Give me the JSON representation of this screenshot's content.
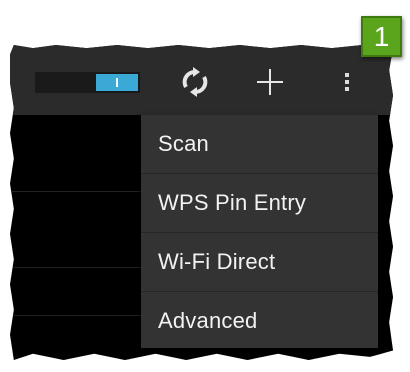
{
  "action_bar": {
    "wifi_toggle": {
      "thumb_label": "I",
      "state": "on",
      "accent_color": "#3aa9d6"
    },
    "icons": [
      "refresh-icon",
      "plus-icon",
      "overflow-menu-icon"
    ]
  },
  "overflow_menu": {
    "items": [
      {
        "label": "Scan"
      },
      {
        "label": "WPS Pin Entry"
      },
      {
        "label": "Wi-Fi Direct"
      },
      {
        "label": "Advanced"
      }
    ]
  },
  "callout": {
    "number": "1",
    "color": "#5aa51c"
  }
}
